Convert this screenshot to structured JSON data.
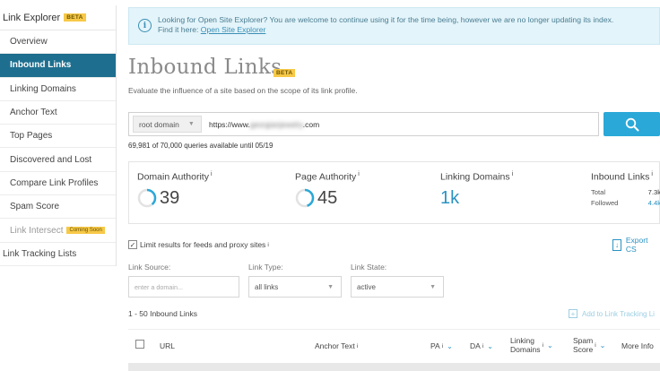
{
  "sidebar": {
    "title": "Link Explorer",
    "beta": "BETA",
    "items": [
      {
        "label": "Overview"
      },
      {
        "label": "Inbound Links"
      },
      {
        "label": "Linking Domains"
      },
      {
        "label": "Anchor Text"
      },
      {
        "label": "Top Pages"
      },
      {
        "label": "Discovered and Lost"
      },
      {
        "label": "Compare Link Profiles"
      },
      {
        "label": "Spam Score"
      },
      {
        "label": "Link Intersect",
        "badge": "Coming Soon"
      }
    ],
    "footer": "Link Tracking Lists"
  },
  "notice": {
    "line1": "Looking for Open Site Explorer? You are welcome to continue using it for the time being, however we are no longer updating its index.",
    "line2_prefix": "Find it here: ",
    "link": "Open Site Explorer",
    "icon": "info-icon"
  },
  "page": {
    "title": "Inbound Links",
    "beta": "BETA",
    "subtitle": "Evaluate the influence of a site based on the scope of its link profile."
  },
  "search": {
    "scope": "root domain",
    "url_prefix": "https://www.",
    "url_blurred": "georgianjewelry",
    "url_suffix": ".com",
    "quota": "69,981 of 70,000 queries available until 05/19"
  },
  "metrics": {
    "domain_authority": {
      "label": "Domain Authority",
      "value": "39",
      "fill": 0.39
    },
    "page_authority": {
      "label": "Page Authority",
      "value": "45",
      "fill": 0.45
    },
    "linking_domains": {
      "label": "Linking Domains",
      "value": "1k"
    },
    "inbound_links": {
      "label": "Inbound Links",
      "total_label": "Total",
      "total_value": "7.3k",
      "followed_label": "Followed",
      "followed_value": "4.4k"
    },
    "info_mark": "i"
  },
  "filters": {
    "limit_label": "Limit results for feeds and proxy sites",
    "export": "Export CS",
    "link_source_label": "Link Source:",
    "link_source_placeholder": "enter a domain...",
    "link_type_label": "Link Type:",
    "link_type_value": "all links",
    "link_state_label": "Link State:",
    "link_state_value": "active"
  },
  "results": {
    "count": "1 - 50  Inbound Links",
    "add_tracking": "Add to Link Tracking Li"
  },
  "table": {
    "url": "URL",
    "anchor": "Anchor Text",
    "pa": "PA",
    "da": "DA",
    "linking_line1": "Linking",
    "linking_line2": "Domains",
    "spam_line1": "Spam",
    "spam_line2": "Score",
    "more": "More Info"
  },
  "colors": {
    "active_nav": "#1e6f8f",
    "accent": "#2aa8d8",
    "ring": "#2aa8d8"
  }
}
